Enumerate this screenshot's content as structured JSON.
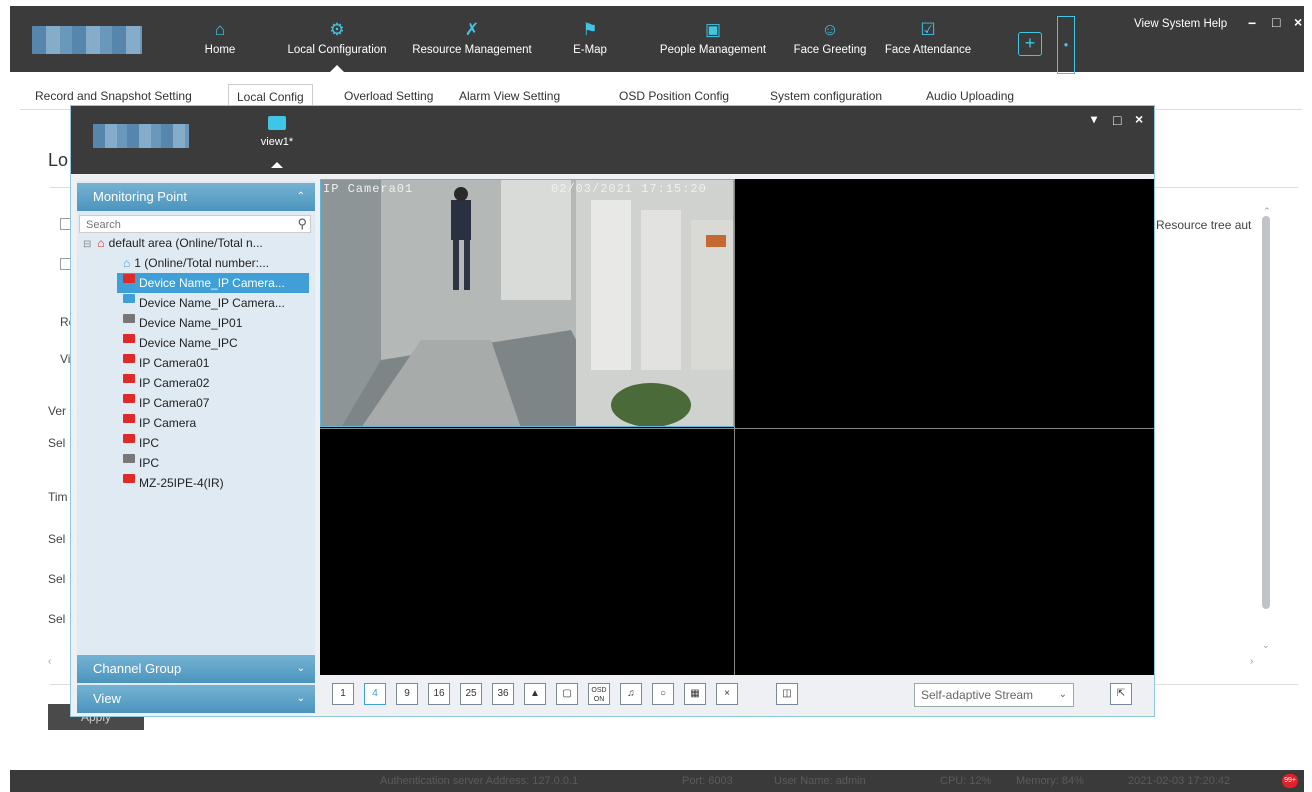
{
  "topbar": {
    "nav": [
      {
        "label": "Home",
        "icon": "home-icon"
      },
      {
        "label": "Local Configuration",
        "icon": "gear-icon"
      },
      {
        "label": "Resource Management",
        "icon": "tools-icon"
      },
      {
        "label": "E-Map",
        "icon": "flag-icon"
      },
      {
        "label": "People Management",
        "icon": "folder-person-icon"
      },
      {
        "label": "Face Greeting",
        "icon": "face-scan-icon"
      },
      {
        "label": "Face Attendance",
        "icon": "calendar-check-icon"
      }
    ],
    "plus": "+",
    "menu": "View System Help",
    "minimize": "−",
    "maximize": "□",
    "close": "×"
  },
  "tabs": [
    "Record and Snapshot Setting",
    "Local Config",
    "Overload Setting",
    "Alarm View Setting",
    "OSD Position Config",
    "System configuration",
    "Audio Uploading"
  ],
  "background_page": {
    "title": "Lo",
    "rows": [
      "Re",
      "Vi",
      "Ver",
      "Sel",
      "Tim",
      "Sel",
      "Sel",
      "Sel"
    ],
    "right_text": "Resource tree aut",
    "apply": "Apply"
  },
  "popup": {
    "view_tab": "view1*",
    "controls": {
      "dropdown": "▾",
      "maximize": "□",
      "close": "×"
    },
    "left_panel": {
      "monitoring_point": "Monitoring Point",
      "search_placeholder": "Search",
      "tree": [
        {
          "label": "default area (Online/Total n...",
          "kind": "area",
          "color": "#e02a2a"
        },
        {
          "label": "1 (Online/Total number:...",
          "kind": "area",
          "color": "#3f9fd6"
        },
        {
          "label": "Device Name_IP Camera...",
          "kind": "cam",
          "color": "#e02a2a",
          "selected": true
        },
        {
          "label": "Device Name_IP Camera...",
          "kind": "cam",
          "color": "#3f9fd6"
        },
        {
          "label": "Device Name_IP01",
          "kind": "cam",
          "color": "#777777"
        },
        {
          "label": "Device Name_IPC",
          "kind": "cam",
          "color": "#e02a2a"
        },
        {
          "label": "IP Camera01",
          "kind": "cam",
          "color": "#e02a2a"
        },
        {
          "label": "IP Camera02",
          "kind": "cam",
          "color": "#e02a2a"
        },
        {
          "label": "IP Camera07",
          "kind": "cam",
          "color": "#e02a2a"
        },
        {
          "label": "IP Camera",
          "kind": "cam",
          "color": "#e02a2a"
        },
        {
          "label": "IPC",
          "kind": "cam",
          "color": "#e02a2a"
        },
        {
          "label": "IPC",
          "kind": "cam",
          "color": "#777777"
        },
        {
          "label": "MZ-25IPE-4(IR)",
          "kind": "cam",
          "color": "#e02a2a"
        }
      ],
      "channel_group": "Channel Group",
      "view": "View"
    },
    "video": {
      "osd_name": "IP Camera01",
      "osd_time": "02/03/2021 17:15:20"
    },
    "toolbar": {
      "layouts": [
        "1",
        "4",
        "9",
        "16",
        "25",
        "36"
      ],
      "stream": "Self-adaptive Stream",
      "osd_label": "OSD ON"
    }
  },
  "statusbar": {
    "auth": "Authentication server  Address: 127.0.0.1",
    "port": "Port: 6003",
    "user": "User Name: admin",
    "cpu": "CPU: 12%",
    "memory": "Memory: 84%",
    "datetime": "2021-02-03 17:20:42",
    "badge": "99+"
  }
}
